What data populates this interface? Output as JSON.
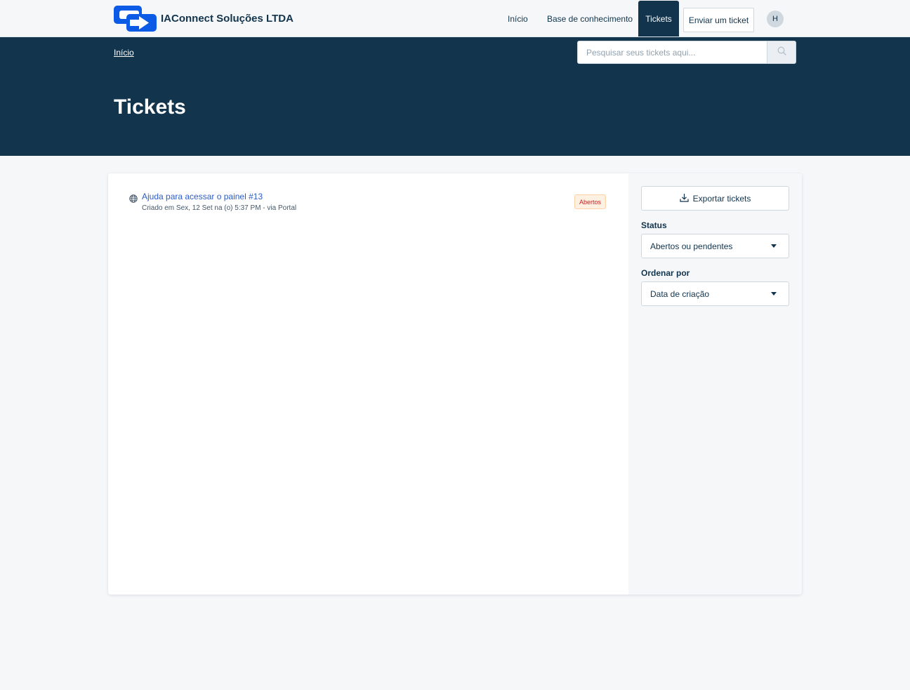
{
  "header": {
    "brand_name": "IAConnect Soluções LTDA",
    "nav": {
      "home": "Início",
      "knowledge_base": "Base de conhecimento",
      "tickets": "Tickets",
      "submit_ticket": "Enviar um ticket"
    },
    "avatar_initial": "H"
  },
  "hero": {
    "breadcrumb": "Início",
    "search_placeholder": "Pesquisar seus tickets aqui...",
    "title": "Tickets"
  },
  "tickets": [
    {
      "title": "Ajuda para acessar o painel #13",
      "meta": "Criado em Sex, 12 Set na (o) 5:37 PM - via Portal",
      "status": "Abertos",
      "icon": "globe-icon"
    }
  ],
  "sidebar": {
    "export_label": "Exportar tickets",
    "status_label": "Status",
    "status_value": "Abertos ou pendentes",
    "sort_label": "Ordenar por",
    "sort_value": "Data de criação"
  },
  "colors": {
    "brand": "#12344d",
    "link": "#2c5cc5",
    "logo": "#0b5be6",
    "badge_bg": "#fef1e1",
    "badge_text": "#c82124"
  }
}
